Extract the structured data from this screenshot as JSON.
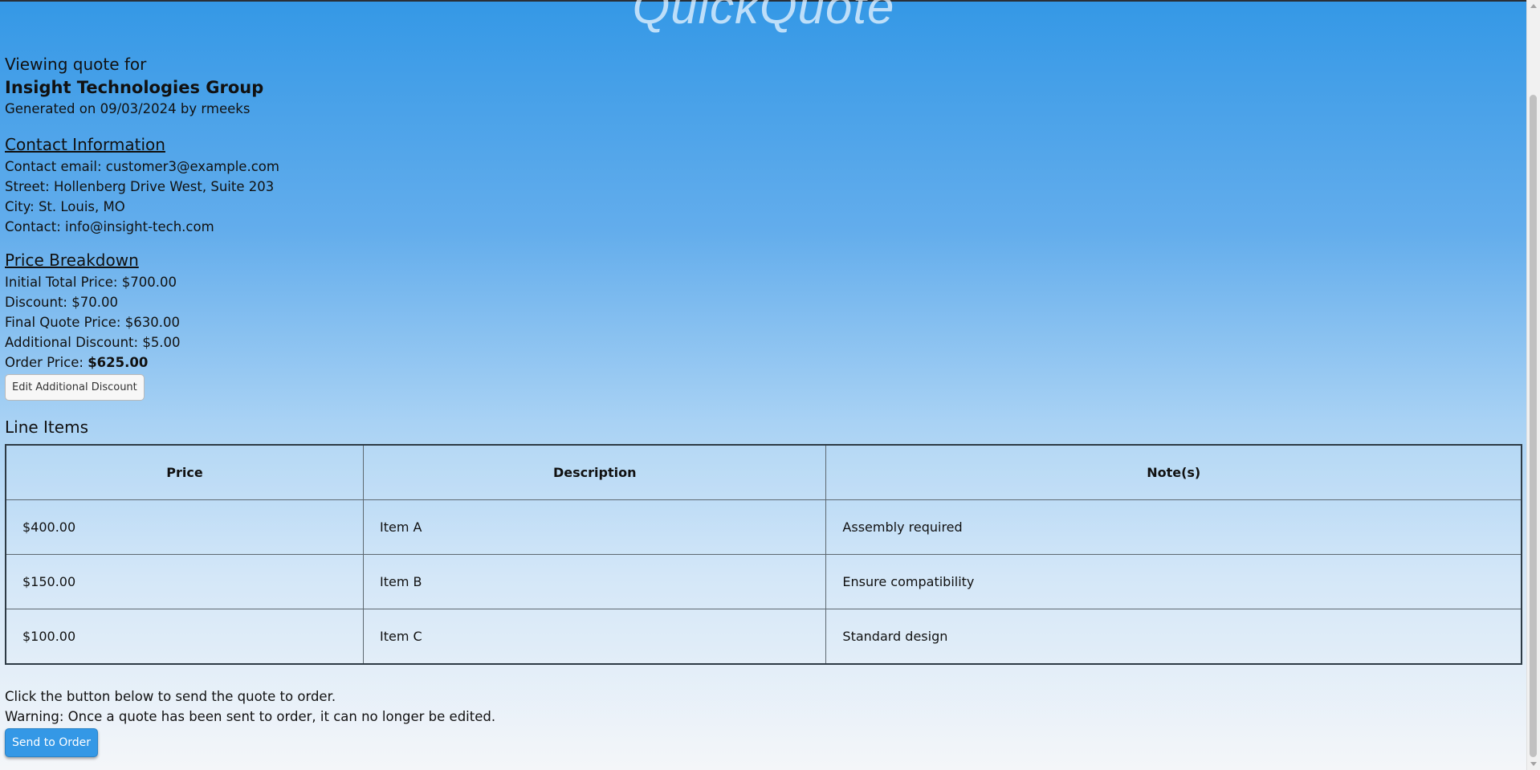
{
  "app": {
    "brand": "QuickQuote"
  },
  "quote": {
    "viewing_label": "Viewing quote for",
    "company": "Insight Technologies Group",
    "generated": "Generated on 09/03/2024 by rmeeks"
  },
  "contact": {
    "title": "Contact Information",
    "lines": [
      "Contact email: customer3@example.com",
      "Street: Hollenberg Drive West, Suite 203",
      "City: St. Louis, MO",
      "Contact: info@insight-tech.com"
    ]
  },
  "price": {
    "title": "Price Breakdown",
    "lines": [
      "Initial Total Price: $700.00",
      "Discount: $70.00",
      "Final Quote Price: $630.00",
      "Additional Discount: $5.00"
    ],
    "order_label": "Order Price: ",
    "order_value": "$625.00",
    "edit_button": "Edit Additional Discount"
  },
  "line_items": {
    "title": "Line Items",
    "headers": [
      "Price",
      "Description",
      "Note(s)"
    ],
    "rows": [
      {
        "price": "$400.00",
        "description": "Item A",
        "note": "Assembly required"
      },
      {
        "price": "$150.00",
        "description": "Item B",
        "note": "Ensure compatibility"
      },
      {
        "price": "$100.00",
        "description": "Item C",
        "note": "Standard design"
      }
    ]
  },
  "footer": {
    "instruction": "Click the button below to send the quote to order.",
    "warning": "Warning: Once a quote has been sent to order, it can no longer be edited.",
    "send_button": "Send to Order"
  },
  "colors": {
    "accent": "#3498e6",
    "table_border": "#2d3a44"
  }
}
